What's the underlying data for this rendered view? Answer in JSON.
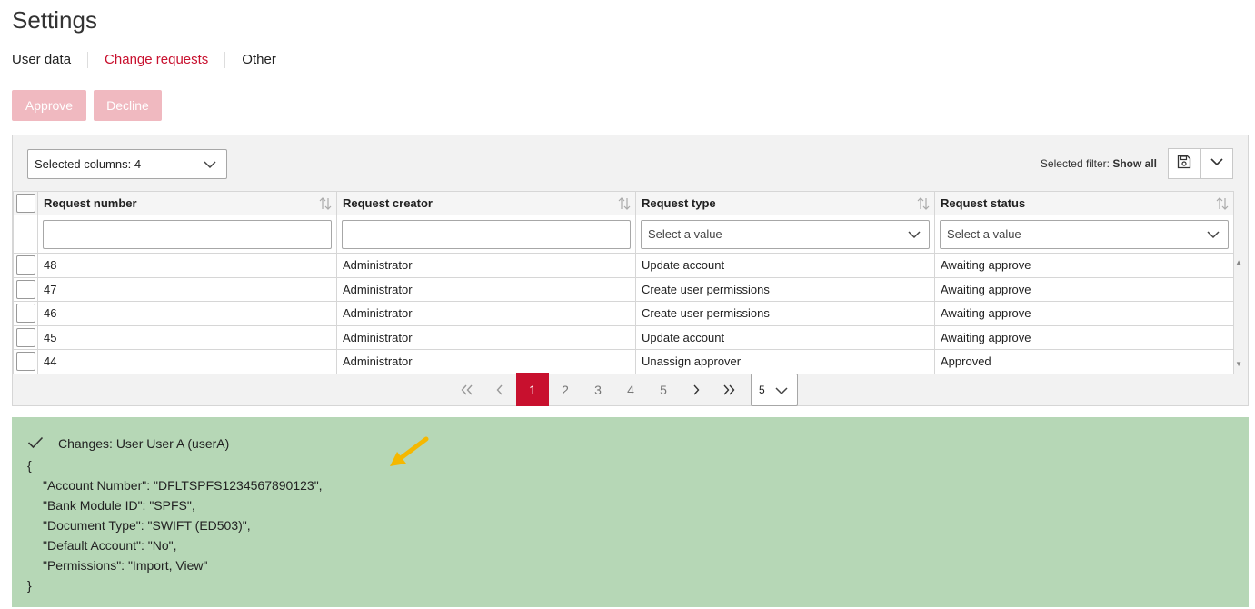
{
  "page": {
    "title": "Settings"
  },
  "tabs": [
    {
      "label": "User data",
      "active": false
    },
    {
      "label": "Change requests",
      "active": true
    },
    {
      "label": "Other",
      "active": false
    }
  ],
  "actions": {
    "approve": "Approve",
    "decline": "Decline"
  },
  "toolbar": {
    "columns_select": "Selected columns: 4",
    "filter_label": "Selected filter:",
    "filter_value": "Show all"
  },
  "grid": {
    "headers": [
      "Request number",
      "Request creator",
      "Request type",
      "Request status"
    ],
    "filter_placeholder": "Select a value",
    "rows": [
      [
        "48",
        "Administrator",
        "Update account",
        "Awaiting approve"
      ],
      [
        "47",
        "Administrator",
        "Create user permissions",
        "Awaiting approve"
      ],
      [
        "46",
        "Administrator",
        "Create user permissions",
        "Awaiting approve"
      ],
      [
        "45",
        "Administrator",
        "Update account",
        "Awaiting approve"
      ],
      [
        "44",
        "Administrator",
        "Unassign approver",
        "Approved"
      ]
    ]
  },
  "pagination": {
    "pages": [
      "1",
      "2",
      "3",
      "4",
      "5"
    ],
    "current": "1",
    "page_size": "5"
  },
  "changes": {
    "title": "Changes: User User A (userA)",
    "open_brace": "{",
    "close_brace": "}",
    "lines": [
      "\"Account Number\": \"DFLTSPFS1234567890123\",",
      "\"Bank Module ID\": \"SPFS\",",
      "\"Document Type\": \"SWIFT (ED503)\",",
      "\"Default Account\": \"No\",",
      "\"Permissions\": \"Import, View\""
    ]
  },
  "colors": {
    "accent": "#c8102e",
    "disabled_button": "#f0b9c0",
    "changes_bg": "#b6d7b6",
    "annotation_arrow": "#f5b800"
  }
}
